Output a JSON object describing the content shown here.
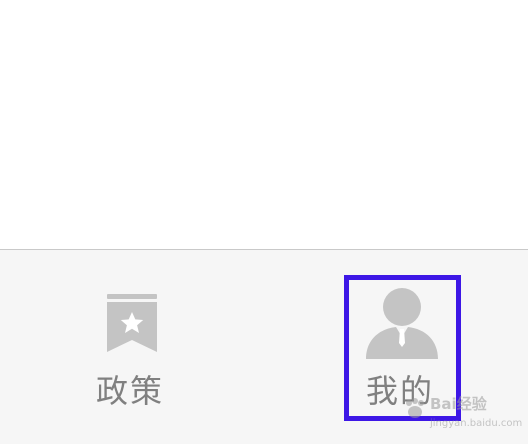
{
  "tab_bar": {
    "tabs": [
      {
        "label": "政策",
        "icon": "bookmark-star-icon",
        "selected": false
      },
      {
        "label": "我的",
        "icon": "user-profile-icon",
        "selected": true
      }
    ],
    "icon_color": "#c4c4c4",
    "label_color": "#808080",
    "background": "#f6f6f6"
  },
  "highlight": {
    "color": "#3d17e6",
    "target": "我的"
  },
  "watermark": {
    "line1": "Bai经验",
    "line2": "jingyan.baidu.com"
  }
}
